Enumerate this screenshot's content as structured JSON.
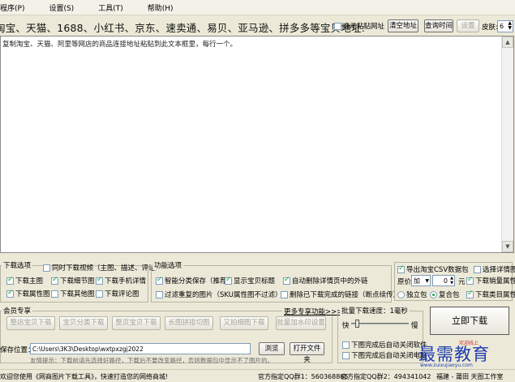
{
  "menu": [
    "程序(P)",
    "设置(S)",
    "工具(T)",
    "帮助(H)"
  ],
  "url_bar": {
    "title": "淘宝、天猫、1688、小红书、京东、速卖通、易贝、亚马逊、拼多多等宝贝地址:",
    "auto_paste": "自动粘贴网址",
    "clear_btn": "清空地址",
    "query_btn": "查询时间",
    "settings_btn": "设置",
    "skin_label": "皮肤:",
    "skin_value": "6"
  },
  "textarea_hint": "复制淘宝、天猫、阿里等网店的商品连接地址粘贴到此文本框里，每行一个。",
  "download_options": {
    "title": "下载选项",
    "items": [
      {
        "label": "下载主图",
        "checked": true
      },
      {
        "label": "下载细节图",
        "checked": true
      },
      {
        "label": "下载手机详情",
        "checked": true
      },
      {
        "label": "下载属性图",
        "checked": true
      },
      {
        "label": "下载其他图",
        "checked": false
      },
      {
        "label": "下载评论图",
        "checked": false
      }
    ],
    "video": {
      "label": "同时下载视频（主图、描述、评论）",
      "checked": false
    }
  },
  "function_options": {
    "title": "功能选项",
    "items": [
      {
        "label": "智能分类保存（推荐）",
        "checked": true
      },
      {
        "label": "显示宝贝标题",
        "checked": true
      },
      {
        "label": "自动删除详情页中的外链",
        "checked": true
      },
      {
        "label": "过滤重复的图片（SKU属性图不过滤）",
        "checked": false
      },
      {
        "label": "删除已下载完成的链接（断点续传）",
        "checked": false
      }
    ]
  },
  "right_options": {
    "csv": {
      "label": "导出淘宝CSV数据包",
      "checked": true
    },
    "detail_img": {
      "label": "选择详情图",
      "checked": false
    },
    "price_label": "原价",
    "price_op": "加",
    "price_value": "0",
    "price_unit": "元",
    "sales_attr": {
      "label": "下载销量属性",
      "checked": true
    },
    "single_pkg": {
      "label": "独立包",
      "checked": false
    },
    "multi_pkg": {
      "label": "复合包",
      "checked": true
    },
    "category_attr": {
      "label": "下载类目属性",
      "checked": true
    }
  },
  "member": {
    "title": "会员专享",
    "more": "更多专享功能>>>",
    "buttons": [
      "整店宝贝下载",
      "宝贝分类下载",
      "整页宝贝下载",
      "长图拼接切图",
      "又拍细图下载",
      "批量加水印设置"
    ]
  },
  "save": {
    "label": "保存位置：",
    "path": "C:\\Users\\3K3\\Desktop\\wxtpxzgj2022",
    "browse": "浏览",
    "open": "打开文件夹",
    "tip": "友情提示：下载前请先选择好路径，下载后不要改变路径，否则数据包中显示不了图片的。"
  },
  "batch": {
    "title": "批量下载速度：1毫秒",
    "fast": "快",
    "slow": "慢",
    "speed": 0.08,
    "close_software": {
      "label": "下图完成后自动关闭软件",
      "checked": false
    },
    "close_pc": {
      "label": "下图完成后自动关闭电脑",
      "checked": false
    }
  },
  "download_now": "立即下载",
  "status": {
    "welcome": "欢迎您使用《网商图片下载工具》，快速打造您的网络商城!",
    "qq1": "官方指定QQ群1：560368865",
    "qq2": "官方指定QQ群2：494341042",
    "studio": "福建 - 莆田 天图工作室"
  },
  "watermark": {
    "brand": "最需教育",
    "sub": "欢迎线上",
    "sub2": "www.zuixujiaoyu.com"
  }
}
